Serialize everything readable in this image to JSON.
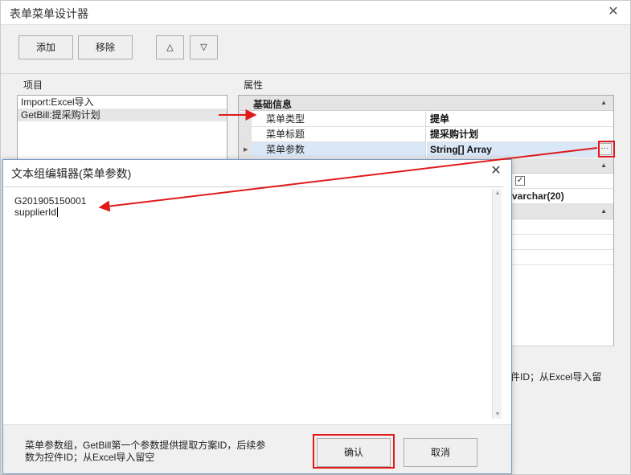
{
  "outer": {
    "title": "表单菜单设计器",
    "close_glyph": "✕"
  },
  "toolbar": {
    "add_label": "添加",
    "remove_label": "移除",
    "up_glyph": "△",
    "down_glyph": "▽"
  },
  "items_panel": {
    "label": "项目",
    "items": [
      {
        "label": "Import:Excel导入"
      },
      {
        "label": "GetBill:提采购计划"
      }
    ]
  },
  "props_panel": {
    "label": "属性",
    "category": "基础信息",
    "rows": [
      {
        "name": "菜单类型",
        "value": "提单"
      },
      {
        "name": "菜单标题",
        "value": "提采购计划"
      },
      {
        "name": "菜单参数",
        "value": "String[] Array"
      }
    ],
    "ellipsis": "···",
    "partial_value": "varchar(20)",
    "partial_desc": "件ID；从Excel导入留"
  },
  "dialog": {
    "title": "文本组编辑器(菜单参数)",
    "close_glyph": "✕",
    "lines": [
      "G201905150001",
      "supplierId"
    ],
    "hint": "菜单参数组，GetBill第一个参数提供提取方案ID，后续参数为控件ID；从Excel导入留空",
    "ok_label": "确认",
    "cancel_label": "取消"
  },
  "colors": {
    "annotation": "#e01a1a",
    "selected_row": "#d9e7f7",
    "category_bg": "#e4e4e4"
  }
}
